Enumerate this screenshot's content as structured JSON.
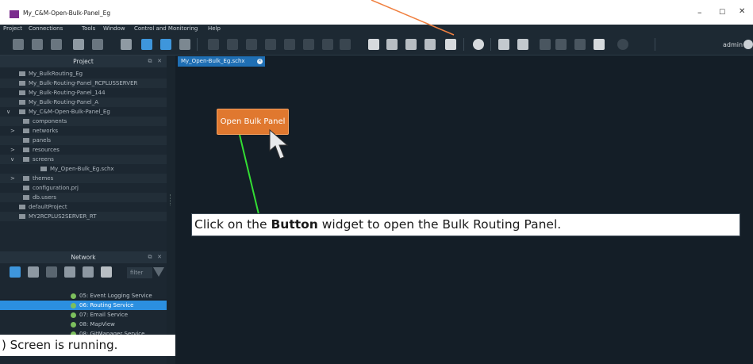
{
  "window": {
    "title": "My_C&M-Open-Bulk-Panel_Eg",
    "minimize": "–",
    "maximize": "☐",
    "close": "✕"
  },
  "menu": [
    "Project",
    "Connections",
    "Tools",
    "Window",
    "Control and Monitoring",
    "Help"
  ],
  "toolbar": {
    "user": "admin"
  },
  "project_panel": {
    "title": "Project",
    "float": "⧉",
    "close": "✕",
    "items": [
      {
        "label": "My_BulkRouting_Eg",
        "indent": 0
      },
      {
        "label": "My_Bulk-Routing-Panel_RCPLUSSERVER",
        "indent": 0
      },
      {
        "label": "My_Bulk-Routing-Panel_144",
        "indent": 0
      },
      {
        "label": "My_Bulk-Routing-Panel_A",
        "indent": 0
      },
      {
        "label": "My_C&M-Open-Bulk-Panel_Eg",
        "indent": 0
      },
      {
        "label": "components",
        "indent": 1
      },
      {
        "label": "networks",
        "indent": 1
      },
      {
        "label": "panels",
        "indent": 1
      },
      {
        "label": "resources",
        "indent": 1
      },
      {
        "label": "screens",
        "indent": 1
      },
      {
        "label": "My_Open-Bulk_Eg.schx",
        "indent": 2
      },
      {
        "label": "themes",
        "indent": 1
      },
      {
        "label": "configuration.prj",
        "indent": 1
      },
      {
        "label": "db.users",
        "indent": 1
      },
      {
        "label": "defaultProject",
        "indent": 0
      },
      {
        "label": "MY2RCPLUS2SERVER_RT",
        "indent": 0
      }
    ]
  },
  "network_panel": {
    "title": "Network",
    "float": "⧉",
    "close": "✕",
    "filter_placeholder": "filter",
    "services": [
      {
        "label": "05: Event Logging Service",
        "selected": false
      },
      {
        "label": "06: Routing Service",
        "selected": true
      },
      {
        "label": "07: Email Service",
        "selected": false
      },
      {
        "label": "08: MapView",
        "selected": false
      },
      {
        "label": "08: GitManager Service",
        "selected": false
      }
    ]
  },
  "editor": {
    "tab_label": "My_Open-Bulk_Eg.schx",
    "tab_close": "✕",
    "button_widget_label": "Open Bulk Panel"
  },
  "annotations": {
    "callout_prefix": "Click on the ",
    "callout_bold": "Button",
    "callout_suffix": " widget to open the Bulk Routing Panel.",
    "running_text": ") Screen is running."
  },
  "colors": {
    "button_widget": "#e0782f",
    "selected_row": "#2b8fe0",
    "leader_line": "#33dd33",
    "arrow_line": "#f08040",
    "status_dot": "#7cbf5d"
  }
}
